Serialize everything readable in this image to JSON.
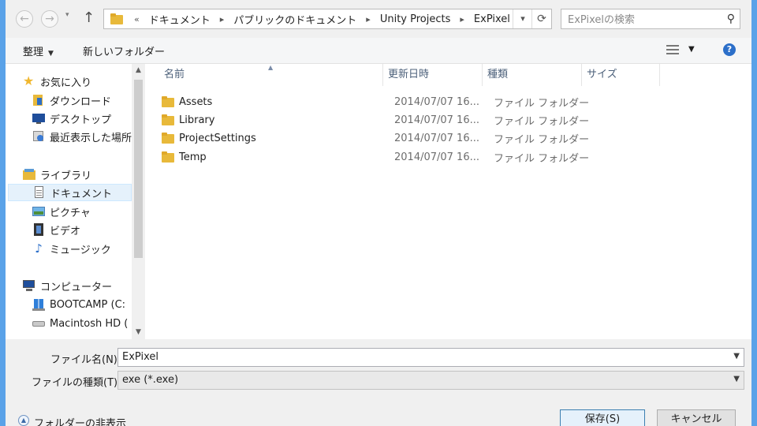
{
  "address_bar": {
    "back_icon": "back-arrow-icon",
    "forward_icon": "forward-arrow-icon",
    "history_caret": "▾",
    "up_icon": "up-arrow-icon",
    "overflow": "«",
    "breadcrumbs": [
      "ドキュメント",
      "パブリックのドキュメント",
      "Unity Projects",
      "ExPixel"
    ],
    "refresh_icon": "refresh-icon"
  },
  "search": {
    "placeholder": "ExPixelの検索"
  },
  "toolbar": {
    "organize": "整理",
    "new_folder": "新しいフォルダー"
  },
  "nav": {
    "favorites": {
      "label": "お気に入り",
      "items": [
        {
          "label": "ダウンロード",
          "icon": "downloads-icon"
        },
        {
          "label": "デスクトップ",
          "icon": "desktop-icon"
        },
        {
          "label": "最近表示した場所",
          "icon": "recent-places-icon"
        }
      ]
    },
    "libraries": {
      "label": "ライブラリ",
      "items": [
        {
          "label": "ドキュメント",
          "icon": "documents-icon",
          "selected": true
        },
        {
          "label": "ピクチャ",
          "icon": "pictures-icon"
        },
        {
          "label": "ビデオ",
          "icon": "videos-icon"
        },
        {
          "label": "ミュージック",
          "icon": "music-icon"
        }
      ]
    },
    "computer": {
      "label": "コンピューター",
      "items": [
        {
          "label": "BOOTCAMP (C:",
          "icon": "windows-drive-icon"
        },
        {
          "label": "Macintosh HD (",
          "icon": "hard-drive-icon"
        }
      ]
    }
  },
  "columns": {
    "name": "名前",
    "date": "更新日時",
    "type": "種類",
    "size": "サイズ"
  },
  "files": [
    {
      "name": "Assets",
      "date": "2014/07/07 16...",
      "type": "ファイル フォルダー"
    },
    {
      "name": "Library",
      "date": "2014/07/07 16...",
      "type": "ファイル フォルダー"
    },
    {
      "name": "ProjectSettings",
      "date": "2014/07/07 16...",
      "type": "ファイル フォルダー"
    },
    {
      "name": "Temp",
      "date": "2014/07/07 16...",
      "type": "ファイル フォルダー"
    }
  ],
  "filename_label": "ファイル名(N):",
  "filename_value": "ExPixel",
  "filetype_label": "ファイルの種類(T):",
  "filetype_value": "exe (*.exe)",
  "hide_folders": "フォルダーの非表示",
  "save_button": "保存(S)",
  "cancel_button": "キャンセル"
}
